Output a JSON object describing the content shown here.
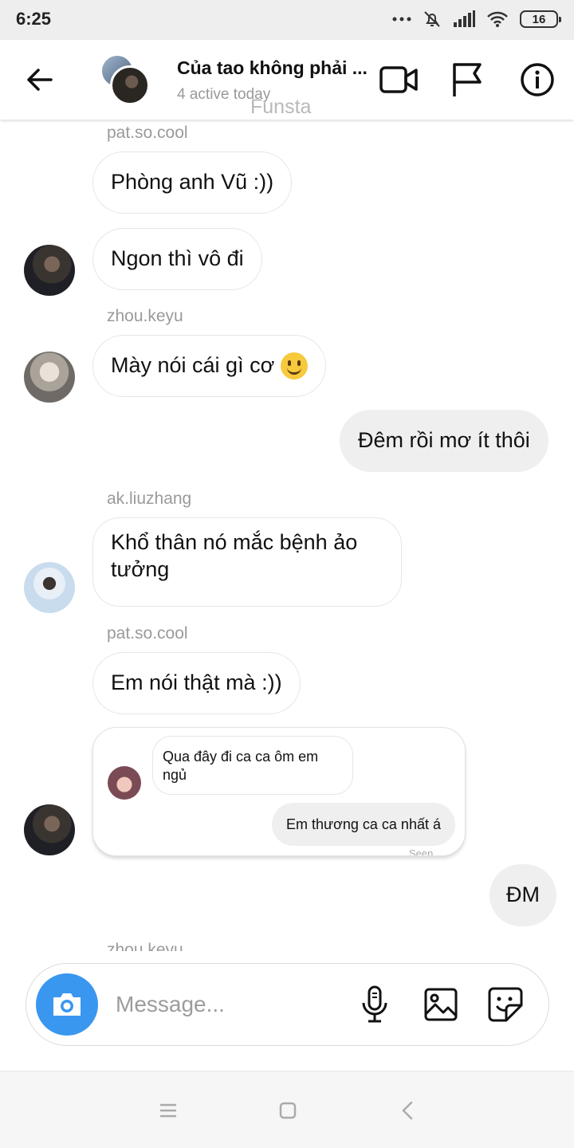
{
  "status_bar": {
    "time": "6:25",
    "battery": "16"
  },
  "header": {
    "title": "Của tao không phải ...",
    "subtitle": "4 active today",
    "watermark": "Funsta"
  },
  "messages": [
    {
      "sender": "pat.so.cool",
      "text": "Phòng anh Vũ :))"
    },
    {
      "text": "Ngon thì vô đi"
    },
    {
      "sender": "zhou.keyu",
      "text": "Mày nói cái gì cơ",
      "emoji": "slightly-smiling-face"
    },
    {
      "mine": true,
      "text": "Đêm rồi mơ ít thôi"
    },
    {
      "sender": "ak.liuzhang",
      "text": "Khổ thân nó mắc bệnh ảo tưởng"
    },
    {
      "sender": "pat.so.cool",
      "text": "Em nói thật mà :))"
    },
    {
      "shared_post": {
        "received": "Qua đây đi ca ca ôm em ngủ",
        "sent": "Em thương ca ca nhất á",
        "seen": "Seen"
      }
    },
    {
      "mine": true,
      "text": "ĐM"
    },
    {
      "sender": "zhou.keyu"
    }
  ],
  "composer": {
    "placeholder": "Message..."
  },
  "colors": {
    "camera_button": "#3a97f0",
    "my_bubble": "#efefef",
    "sender_name": "#9a9a9a"
  },
  "icons": [
    "back-arrow-icon",
    "video-call-icon",
    "flag-icon",
    "info-icon",
    "camera-icon",
    "microphone-icon",
    "image-icon",
    "sticker-icon"
  ]
}
